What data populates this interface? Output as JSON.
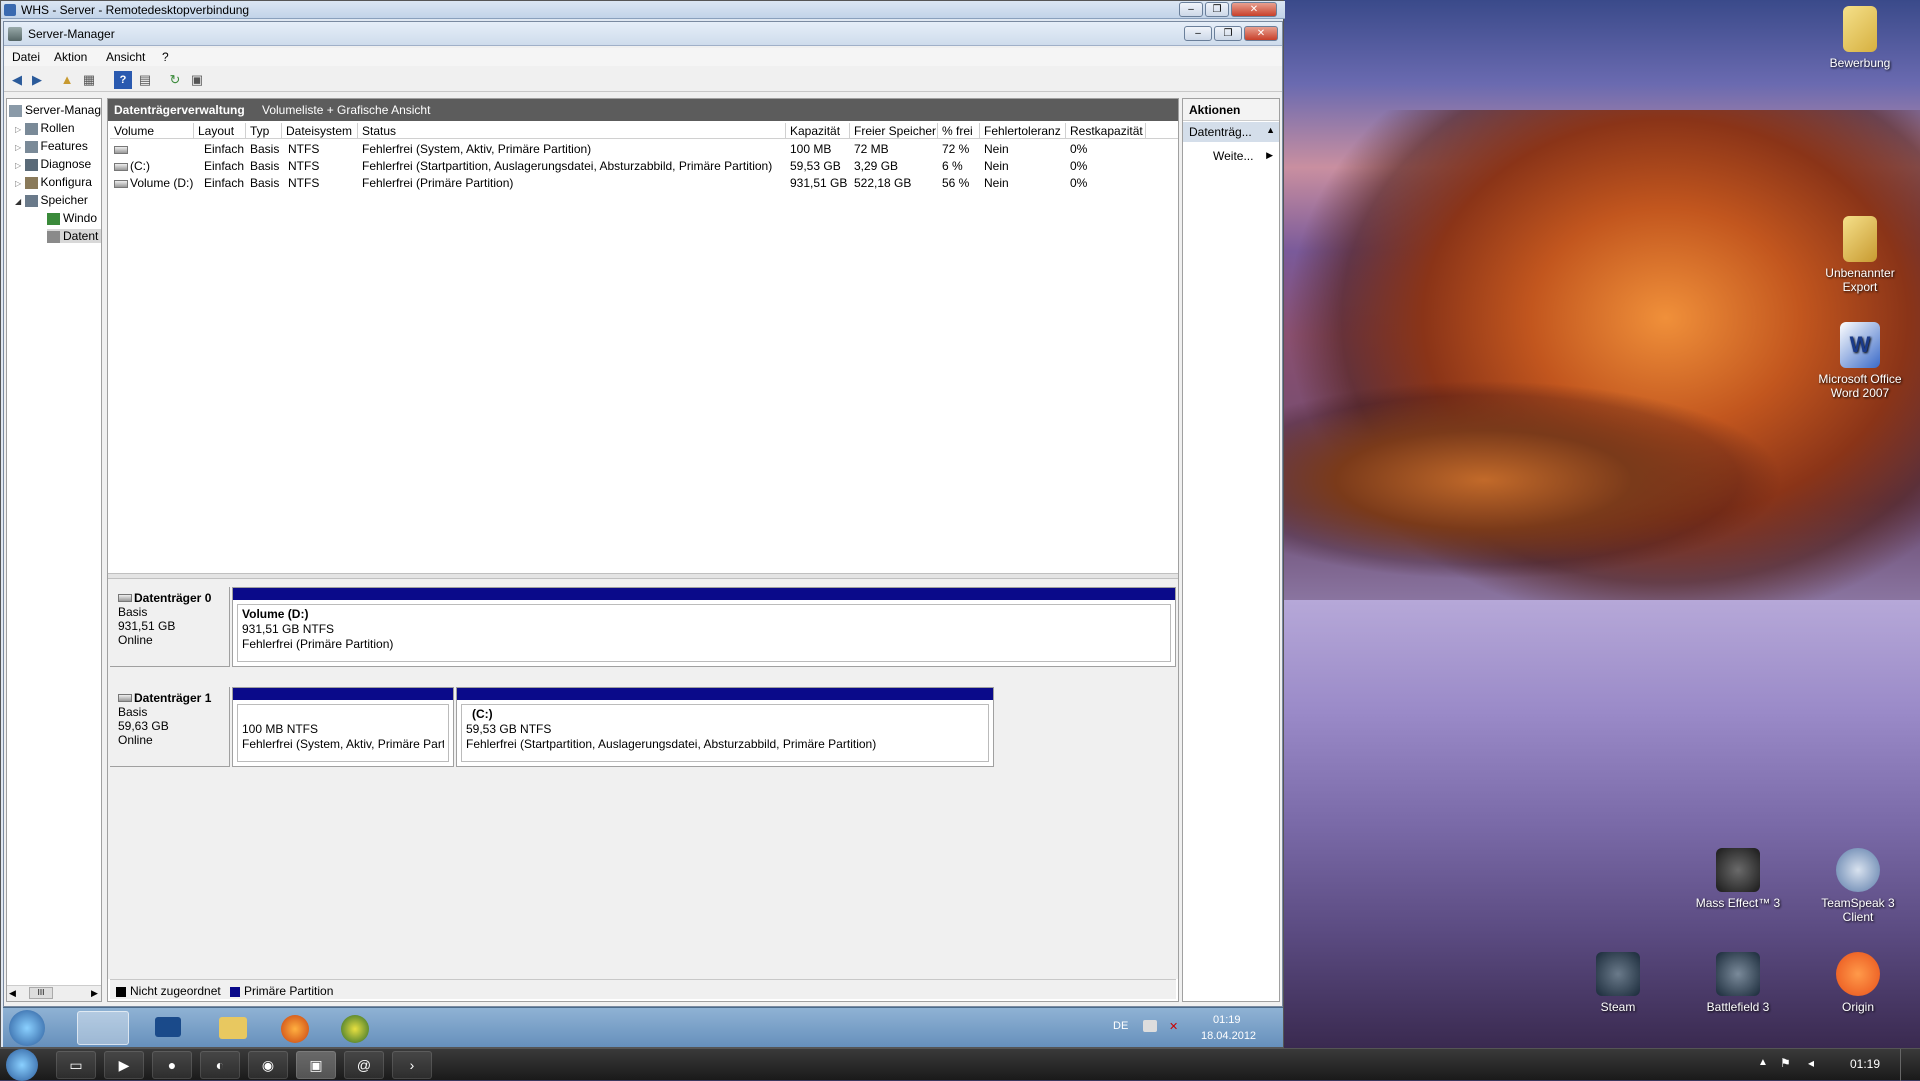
{
  "rdp": {
    "title": "WHS - Server - Remotedesktopverbindung"
  },
  "app": {
    "title": "Server-Manager"
  },
  "menu": [
    "Datei",
    "Aktion",
    "Ansicht",
    "?"
  ],
  "tree": {
    "items": [
      {
        "label": "Server-Manag",
        "indent": 0
      },
      {
        "label": "Rollen",
        "indent": 1
      },
      {
        "label": "Features",
        "indent": 1
      },
      {
        "label": "Diagnose",
        "indent": 1
      },
      {
        "label": "Konfigura",
        "indent": 1
      },
      {
        "label": "Speicher",
        "indent": 1
      },
      {
        "label": "Windo",
        "indent": 2
      },
      {
        "label": "Datent",
        "indent": 2
      }
    ],
    "scroll_label": "III"
  },
  "main": {
    "header_title": "Datenträgerverwaltung",
    "header_sub": "Volumeliste + Grafische Ansicht",
    "columns": [
      "Volume",
      "Layout",
      "Typ",
      "Dateisystem",
      "Status",
      "Kapazität",
      "Freier Speicher",
      "% frei",
      "Fehlertoleranz",
      "Restkapazität"
    ],
    "rows": [
      {
        "volume": "",
        "layout": "Einfach",
        "typ": "Basis",
        "fs": "NTFS",
        "status": "Fehlerfrei (System, Aktiv, Primäre Partition)",
        "cap": "100 MB",
        "free": "72 MB",
        "pct": "72 %",
        "fault": "Nein",
        "rest": "0%"
      },
      {
        "volume": "(C:)",
        "layout": "Einfach",
        "typ": "Basis",
        "fs": "NTFS",
        "status": "Fehlerfrei (Startpartition, Auslagerungsdatei, Absturzabbild, Primäre Partition)",
        "cap": "59,53 GB",
        "free": "3,29 GB",
        "pct": "6 %",
        "fault": "Nein",
        "rest": "0%"
      },
      {
        "volume": "Volume (D:)",
        "layout": "Einfach",
        "typ": "Basis",
        "fs": "NTFS",
        "status": "Fehlerfrei (Primäre Partition)",
        "cap": "931,51 GB",
        "free": "522,18 GB",
        "pct": "56 %",
        "fault": "Nein",
        "rest": "0%"
      }
    ]
  },
  "disks": [
    {
      "name": "Datenträger 0",
      "type": "Basis",
      "size": "931,51 GB",
      "state": "Online",
      "partitions": [
        {
          "name": "Volume  (D:)",
          "size": "931,51 GB NTFS",
          "status": "Fehlerfrei (Primäre Partition)"
        }
      ]
    },
    {
      "name": "Datenträger 1",
      "type": "Basis",
      "size": "59,63 GB",
      "state": "Online",
      "partitions": [
        {
          "name": "",
          "size": "100 MB NTFS",
          "status": "Fehlerfrei (System, Aktiv, Primäre Partit"
        },
        {
          "name": "(C:)",
          "size": "59,53 GB NTFS",
          "status": "Fehlerfrei (Startpartition, Auslagerungsdatei, Absturzabbild, Primäre Partition)"
        }
      ]
    }
  ],
  "legend": {
    "unallocated": "Nicht zugeordnet",
    "primary": "Primäre Partition",
    "primary_color": "#0a0a8a",
    "unallocated_color": "#000000"
  },
  "actions": {
    "title": "Aktionen",
    "item": "Datenträg...",
    "more": "Weite..."
  },
  "inner_tray": {
    "lang": "DE",
    "time": "01:19",
    "date": "18.04.2012"
  },
  "host_tray": {
    "time": "01:19"
  },
  "desktop_icons": [
    {
      "label": "Bewerbung"
    },
    {
      "label": "Unbenannter Export"
    },
    {
      "label": "Microsoft Office Word 2007"
    },
    {
      "label": "Mass Effect™ 3"
    },
    {
      "label": "TeamSpeak 3 Client"
    },
    {
      "label": "Steam"
    },
    {
      "label": "Battlefield 3"
    },
    {
      "label": "Origin"
    }
  ]
}
